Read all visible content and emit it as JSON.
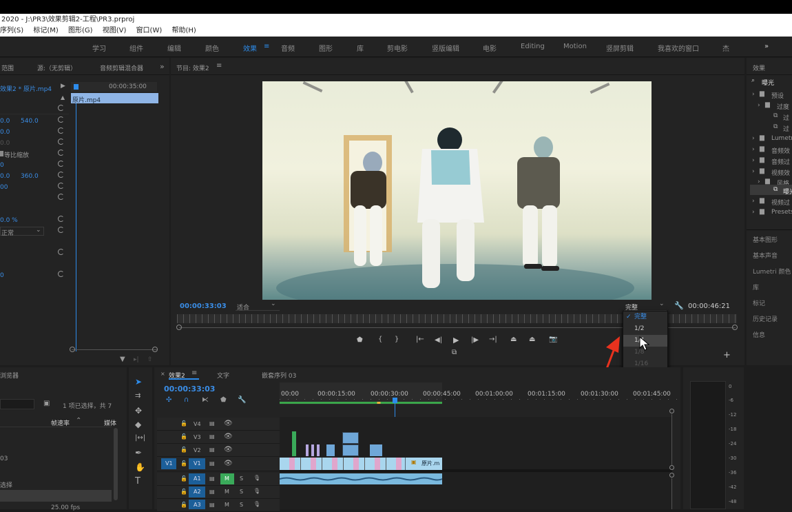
{
  "title_bar": {
    "text": "2020 - J:\\PR3\\效果剪辑2-工程\\PR3.prproj"
  },
  "menu": [
    "序列(S)",
    "标记(M)",
    "图形(G)",
    "视图(V)",
    "窗口(W)",
    "帮助(H)"
  ],
  "workspaces": [
    "学习",
    "组件",
    "编辑",
    "颜色",
    "效果",
    "音频",
    "图形",
    "库",
    "剪电影",
    "竖版编辑",
    "电影",
    "Editing",
    "Motion",
    "竖屏剪辑",
    "我喜欢的窗口",
    "杰"
  ],
  "workspaces_overflow": "»",
  "active_workspace_index": 4,
  "source_panel": {
    "tabs": [
      "范围",
      "源:（无剪辑）",
      "音频剪辑混合器"
    ],
    "clip_header": "效果2 * 原片.mp4",
    "timecode": "00:00:35:00",
    "clip_name": "原片.mp4",
    "values": [
      "0.0",
      "540.0",
      "0.0",
      "0.0",
      "等比缩放",
      "0",
      "0.0",
      "360.0",
      "00",
      "0.0 %",
      "正常",
      "0"
    ]
  },
  "program": {
    "tab": "节目: 效果2",
    "current_time": "00:00:33:03",
    "fit": "适合",
    "quality": "完整",
    "duration": "00:00:46:21",
    "playhead_fraction": 0.83
  },
  "quality_menu": {
    "items": [
      "完整",
      "1/2",
      "1/4",
      "1/8",
      "1/16"
    ],
    "selected_index": 0,
    "hover_index": 2
  },
  "effects_panel": {
    "title": "效果",
    "search": "曝光",
    "tree": [
      "预设",
      "过度",
      "过",
      "过",
      "Lumetri",
      "音频效",
      "音频过",
      "视频效",
      "风格",
      "曝光",
      "视频过",
      "Presets"
    ],
    "panels": [
      "基本图形",
      "基本声音",
      "Lumetri 颜色",
      "库",
      "标记",
      "历史记录",
      "信息"
    ]
  },
  "project_panel": {
    "title": "浏览器",
    "selection_info": "1 项已选择，共 7",
    "col_framerate": "帧速率",
    "col_media": "媒体",
    "rows": [
      "03",
      "选择"
    ],
    "framerate_value": "25.00 fps"
  },
  "timeline": {
    "tabs": [
      "效果2",
      "文字",
      "嵌套序列 03"
    ],
    "timecode": "00:00:33:03",
    "ruler": [
      "00:00",
      "00:00:15:00",
      "00:00:30:00",
      "00:00:45:00",
      "00:01:00:00",
      "00:01:15:00",
      "00:01:30:00",
      "00:01:45:00"
    ],
    "video_tracks": [
      "V4",
      "V3",
      "V2",
      "V1"
    ],
    "audio_tracks": [
      "A1",
      "A2",
      "A3"
    ],
    "source_patch": "V1",
    "track_buttons": {
      "mute": "M",
      "solo": "S"
    },
    "main_clip_label": "原片.m"
  },
  "meter": {
    "scale": [
      "0",
      "-6",
      "-12",
      "-18",
      "-24",
      "-30",
      "-36",
      "-42",
      "-48"
    ]
  },
  "icons": [
    "search-icon",
    "wrench-icon",
    "camera-icon",
    "play-icon",
    "step-back-icon",
    "step-forward-icon",
    "selection-tool-icon",
    "pen-tool-icon",
    "hand-tool-icon",
    "type-tool-icon",
    "eye-icon",
    "lock-icon",
    "microphone-icon"
  ],
  "colors": {
    "accent": "#2d8ceb",
    "video_clip": "#a9d6ee",
    "audio_clip": "#7ab9de",
    "pink_clip": "#e0a6cc",
    "bg": "#1d1d1d"
  }
}
